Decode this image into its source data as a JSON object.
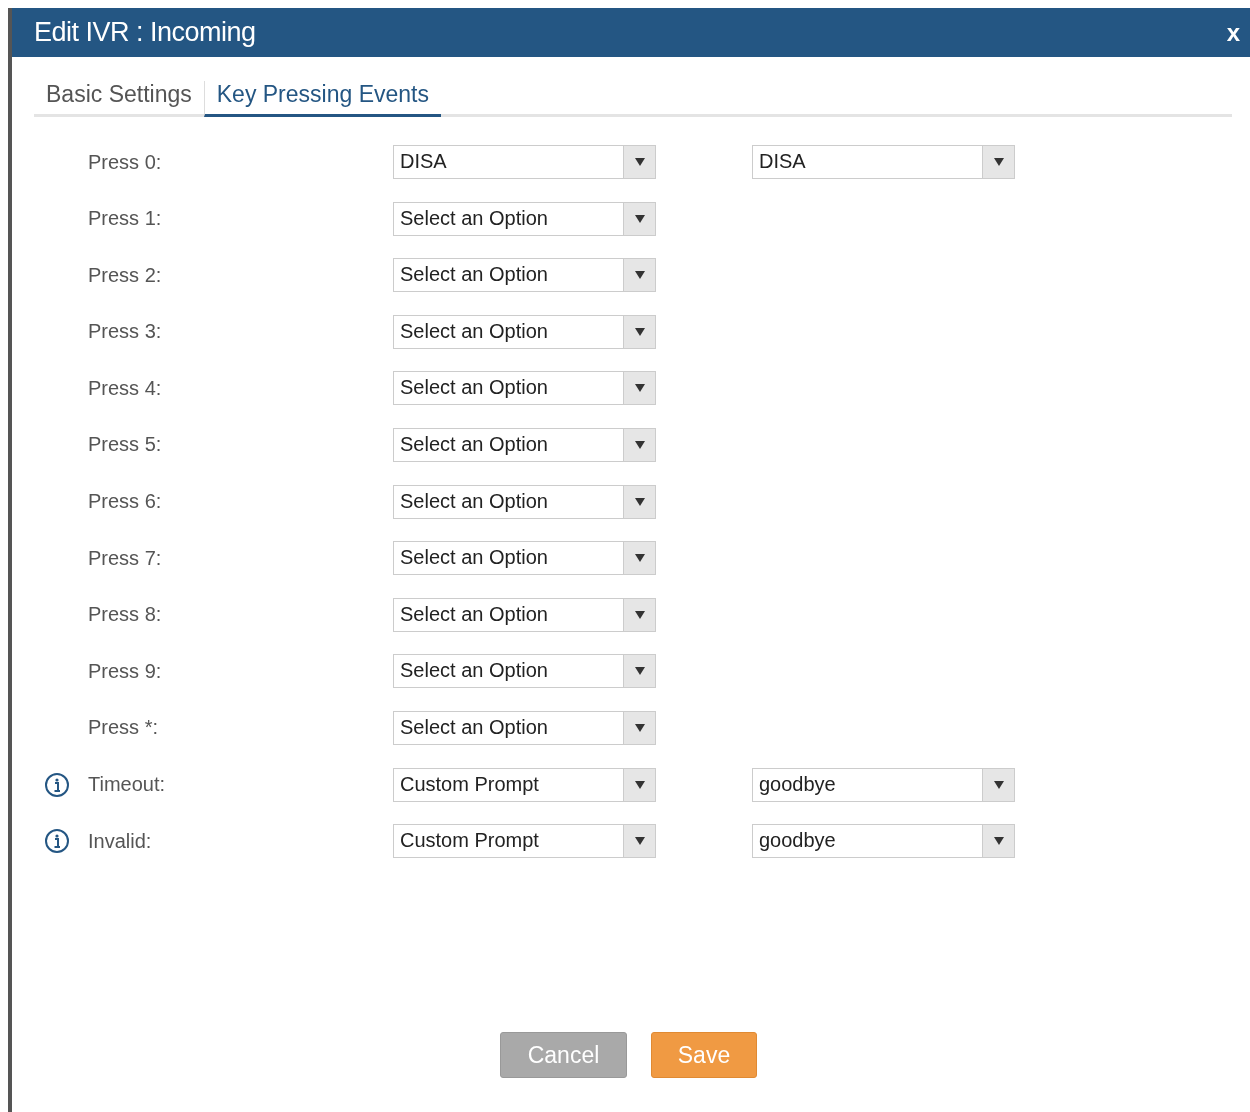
{
  "window": {
    "title": "Edit IVR : Incoming",
    "close": "x"
  },
  "tabs": [
    {
      "label": "Basic Settings",
      "selected": false
    },
    {
      "label": "Key Pressing Events",
      "selected": true
    }
  ],
  "rows": [
    {
      "label": "Press 0:",
      "info": false,
      "selects": [
        "DISA",
        "DISA"
      ]
    },
    {
      "label": "Press 1:",
      "info": false,
      "selects": [
        "Select an Option"
      ]
    },
    {
      "label": "Press 2:",
      "info": false,
      "selects": [
        "Select an Option"
      ]
    },
    {
      "label": "Press 3:",
      "info": false,
      "selects": [
        "Select an Option"
      ]
    },
    {
      "label": "Press 4:",
      "info": false,
      "selects": [
        "Select an Option"
      ]
    },
    {
      "label": "Press 5:",
      "info": false,
      "selects": [
        "Select an Option"
      ]
    },
    {
      "label": "Press 6:",
      "info": false,
      "selects": [
        "Select an Option"
      ]
    },
    {
      "label": "Press 7:",
      "info": false,
      "selects": [
        "Select an Option"
      ]
    },
    {
      "label": "Press 8:",
      "info": false,
      "selects": [
        "Select an Option"
      ]
    },
    {
      "label": "Press 9:",
      "info": false,
      "selects": [
        "Select an Option"
      ]
    },
    {
      "label": "Press *:",
      "info": false,
      "selects": [
        "Select an Option"
      ]
    },
    {
      "label": "Timeout:",
      "info": true,
      "selects": [
        "Custom Prompt",
        "goodbye"
      ]
    },
    {
      "label": "Invalid:",
      "info": true,
      "selects": [
        "Custom Prompt",
        "goodbye"
      ]
    }
  ],
  "buttons": [
    {
      "label": "Cancel",
      "kind": "secondary"
    },
    {
      "label": "Save",
      "kind": "primary"
    }
  ]
}
